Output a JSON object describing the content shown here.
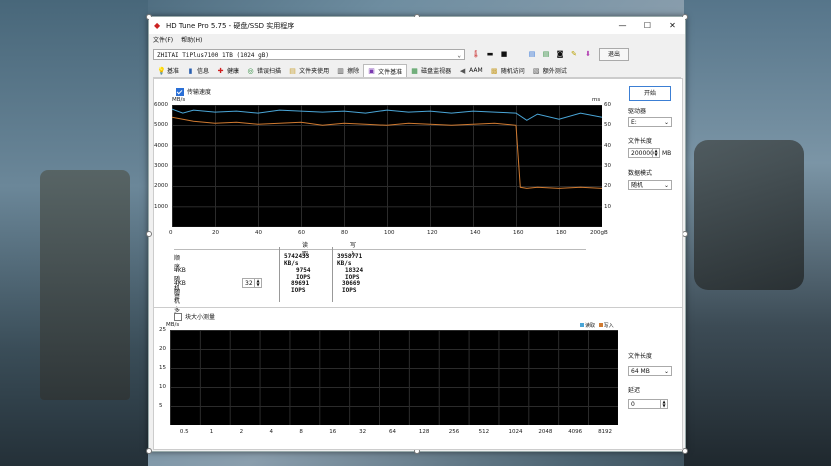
{
  "window": {
    "title": "HD Tune Pro 5.75 - 硬盘/SSD 实用程序",
    "menu": [
      "文件(F)",
      "帮助(H)"
    ],
    "device": "ZHITAI TiPlus7100 1TB (1024 gB)",
    "exit_label": "退出",
    "min_glyph": "—",
    "max_glyph": "☐",
    "close_glyph": "✕"
  },
  "tabs": [
    {
      "label": "基准",
      "icon": "lightbulb-icon",
      "glyph": "💡"
    },
    {
      "label": "信息",
      "icon": "info-icon",
      "glyph": "▮"
    },
    {
      "label": "健康",
      "icon": "health-cross-icon",
      "glyph": "✚"
    },
    {
      "label": "错误扫描",
      "icon": "scan-icon",
      "glyph": "◎"
    },
    {
      "label": "文件夹使用",
      "icon": "folder-icon",
      "glyph": "▤"
    },
    {
      "label": "擦除",
      "icon": "trash-icon",
      "glyph": "▥"
    },
    {
      "label": "文件基准",
      "icon": "file-benchmark-icon",
      "glyph": "▣"
    },
    {
      "label": "磁盘监视器",
      "icon": "monitor-icon",
      "glyph": "▦"
    },
    {
      "label": "AAM",
      "icon": "speaker-icon",
      "glyph": "◀"
    },
    {
      "label": "随机访问",
      "icon": "random-access-icon",
      "glyph": "▩"
    },
    {
      "label": "额外测试",
      "icon": "extra-tests-icon",
      "glyph": "▧"
    }
  ],
  "active_tab": "文件基准",
  "top_test": {
    "checkbox_label": "传输速度",
    "checked": true,
    "unit_left": "MB/s",
    "unit_right": "ms",
    "y_ticks_left": [
      "6000",
      "5000",
      "4000",
      "3000",
      "2000",
      "1000"
    ],
    "y_ticks_right": [
      "60",
      "50",
      "40",
      "30",
      "20",
      "10"
    ],
    "x_ticks": [
      "0",
      "20",
      "40",
      "60",
      "80",
      "100",
      "120",
      "140",
      "160",
      "180",
      "200gB"
    ]
  },
  "chart_data": [
    {
      "type": "line",
      "title": "",
      "xlabel": "",
      "ylabel": "MB/s",
      "xlim": [
        0,
        200
      ],
      "ylim": [
        0,
        6000
      ],
      "series": [
        {
          "name": "读取",
          "color": "#4aa6d8",
          "x": [
            0,
            5,
            10,
            20,
            30,
            40,
            50,
            60,
            70,
            80,
            90,
            100,
            110,
            120,
            130,
            140,
            150,
            160,
            165,
            170,
            180,
            190,
            200
          ],
          "y": [
            5800,
            5600,
            5750,
            5650,
            5700,
            5600,
            5750,
            5700,
            5650,
            5700,
            5600,
            5750,
            5650,
            5700,
            5600,
            5700,
            5650,
            5600,
            5250,
            5550,
            5300,
            5600,
            5400
          ]
        },
        {
          "name": "写入",
          "color": "#d07a30",
          "x": [
            0,
            5,
            10,
            20,
            30,
            40,
            50,
            60,
            70,
            80,
            90,
            100,
            110,
            120,
            130,
            140,
            150,
            160,
            162,
            165,
            170,
            180,
            190,
            200
          ],
          "y": [
            5400,
            5300,
            5200,
            5100,
            5150,
            5050,
            5100,
            5150,
            5000,
            5100,
            5050,
            5000,
            5100,
            5050,
            5000,
            5050,
            5100,
            5000,
            1950,
            1900,
            1950,
            1900,
            1950,
            1900
          ]
        }
      ]
    },
    {
      "type": "bar",
      "title": "",
      "xlabel": "",
      "ylabel": "MB/s",
      "categories": [
        "0.5",
        "1",
        "2",
        "4",
        "8",
        "16",
        "32",
        "64",
        "128",
        "256",
        "512",
        "1024",
        "2048",
        "4096",
        "8192"
      ],
      "ylim": [
        0,
        25
      ],
      "series": [
        {
          "name": "读取",
          "values": []
        },
        {
          "name": "写入",
          "values": []
        }
      ]
    }
  ],
  "results": {
    "col_read": "读取",
    "col_write": "写入",
    "rows": [
      {
        "label": "顺序",
        "read": "5742433 KB/s",
        "write": "3958771 KB/s"
      },
      {
        "label": "4KB 随机单",
        "read": "9754 IOPS",
        "write": "18324 IOPS"
      },
      {
        "label": "4KB 随机多",
        "read": "89691 IOPS",
        "write": "30669 IOPS"
      }
    ],
    "queue_depth": "32"
  },
  "block_test": {
    "checkbox_label": "块大小测量",
    "checked": false,
    "unit": "MB/s",
    "y_ticks": [
      "25",
      "20",
      "15",
      "10",
      "5"
    ],
    "legend_read": "读取",
    "legend_write": "写入"
  },
  "side": {
    "start_label": "开始",
    "drive_label": "驱动器",
    "drive_value": "E:",
    "file_length_label": "文件长度",
    "file_length_value": "200000",
    "file_length_unit": "MB",
    "data_mode_label": "数据模式",
    "data_mode_value": "随机",
    "file_length2_label": "文件长度",
    "file_length2_value": "64 MB",
    "delay_label": "延迟",
    "delay_value": "0"
  },
  "colors": {
    "read": "#4aa6d8",
    "write": "#d07a30",
    "accent": "#3c7fd4"
  }
}
